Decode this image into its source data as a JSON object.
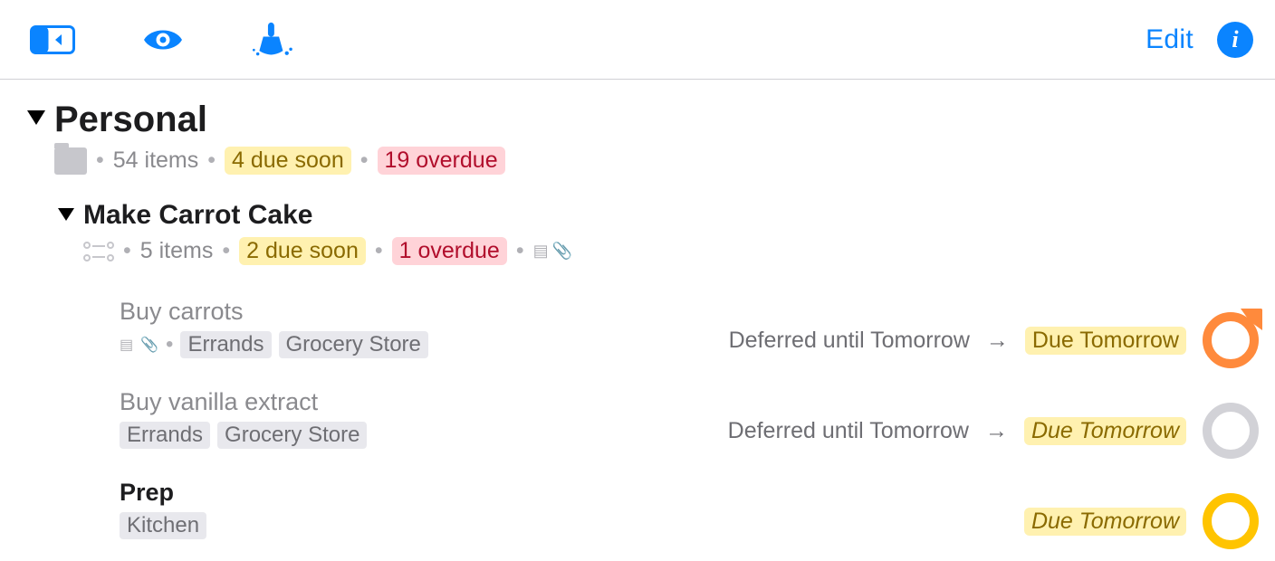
{
  "toolbar": {
    "edit_label": "Edit"
  },
  "folder": {
    "title": "Personal",
    "item_count_label": "54 items",
    "due_soon_label": "4 due soon",
    "overdue_label": "19 overdue"
  },
  "project": {
    "title": "Make Carrot Cake",
    "item_count_label": "5 items",
    "due_soon_label": "2 due soon",
    "overdue_label": "1 overdue",
    "tasks": [
      {
        "title": "Buy carrots",
        "tags": [
          "Errands",
          "Grocery Store"
        ],
        "has_note": true,
        "has_attachment": true,
        "defer_label": "Deferred until Tomorrow",
        "due_label": "Due Tomorrow",
        "due_italic": false,
        "circle": "orange",
        "dim": true
      },
      {
        "title": "Buy vanilla extract",
        "tags": [
          "Errands",
          "Grocery Store"
        ],
        "has_note": false,
        "has_attachment": false,
        "defer_label": "Deferred until Tomorrow",
        "due_label": "Due Tomorrow",
        "due_italic": true,
        "circle": "gray",
        "dim": true
      },
      {
        "title": "Prep",
        "tags": [
          "Kitchen"
        ],
        "has_note": false,
        "has_attachment": false,
        "defer_label": "",
        "due_label": "Due Tomorrow",
        "due_italic": true,
        "circle": "yellow",
        "dim": false
      }
    ]
  }
}
